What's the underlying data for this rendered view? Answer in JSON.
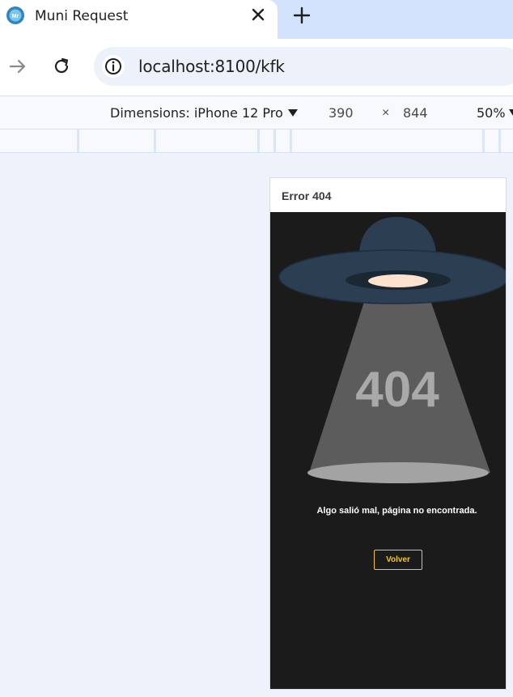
{
  "browser": {
    "tab": {
      "title": "Muni Request",
      "favicon": "muni-request-logo-icon"
    },
    "icons": {
      "close": "close-icon",
      "new_tab": "plus-icon",
      "forward": "arrow-right-icon",
      "reload": "reload-icon",
      "site_info": "info-icon"
    },
    "address": {
      "url": "localhost:8100/kfk"
    }
  },
  "devtools": {
    "device_label": "Dimensions: iPhone 12 Pro",
    "width": "390",
    "times": "×",
    "height": "844",
    "zoom": "50%"
  },
  "app": {
    "header_title": "Error 404",
    "error_code": "404",
    "message": "Algo salió mal, página no encontrada.",
    "button_label": "Volver",
    "colors": {
      "background": "#1b1b1b",
      "accent": "#f5c518",
      "ufo": "#2b3e52",
      "beam": "#5c5c5c",
      "ufo_light": "#fde1cc"
    }
  }
}
